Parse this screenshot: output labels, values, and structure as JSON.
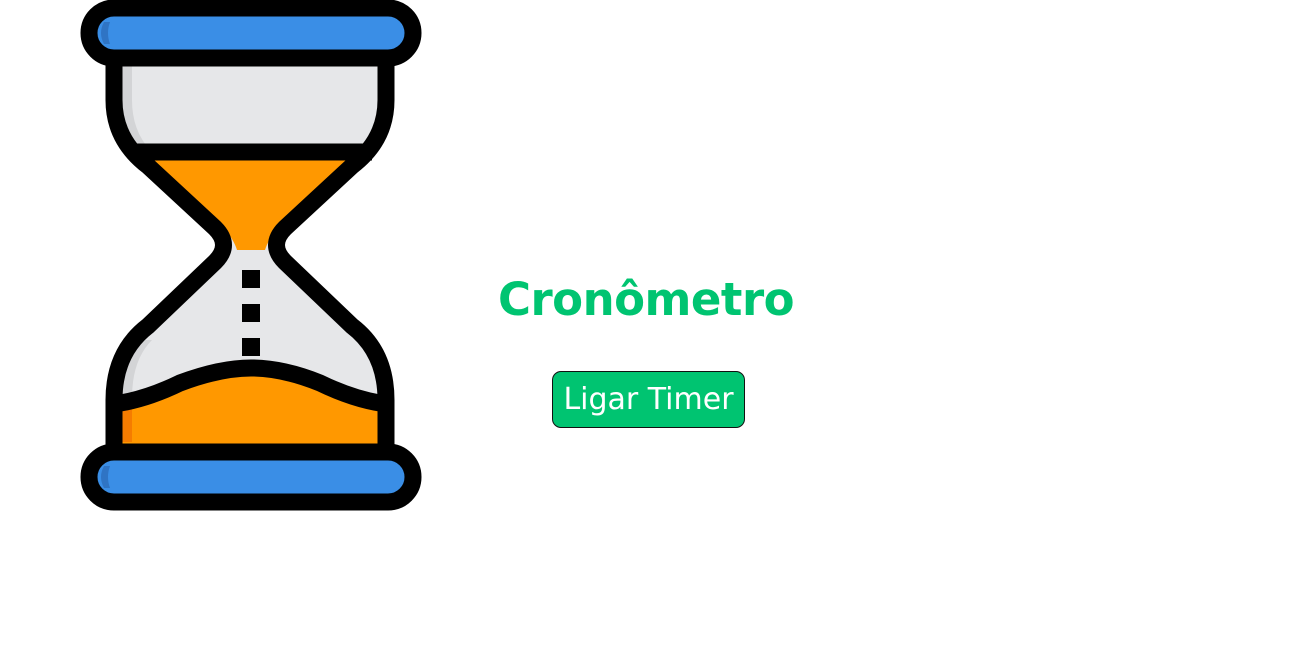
{
  "main": {
    "title": "Cronômetro",
    "start_button_label": "Ligar Timer"
  },
  "illustration": {
    "icon": "hourglass-icon"
  },
  "colors": {
    "accent": "#00c471",
    "button_text": "#ffffff",
    "hourglass_cap": "#3a8ee6",
    "hourglass_sand": "#ff9800",
    "hourglass_glass": "#e6e7e9",
    "outline": "#000000"
  }
}
